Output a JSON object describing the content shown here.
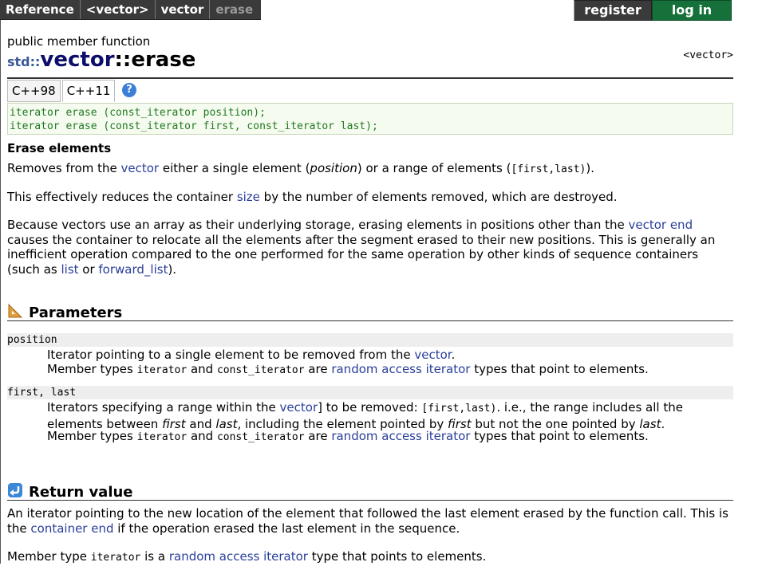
{
  "topbar": {
    "crumbs": [
      "Reference",
      "<vector>",
      "vector",
      "erase"
    ],
    "register": "register",
    "login": "log in"
  },
  "header": {
    "member_type": "public member function",
    "ns": "std::",
    "cls": "vector",
    "sep": "::",
    "fn": "erase",
    "header_tag": "<vector>"
  },
  "tabs": [
    "C++98",
    "C++11"
  ],
  "help_icon": "?",
  "prototypes": [
    "iterator erase (const_iterator position);",
    "iterator erase (const_iterator first, const_iterator last);"
  ],
  "intro": {
    "heading": "Erase elements",
    "p1_a": "Removes from the ",
    "p1_link": "vector",
    "p1_b": " either a single element (",
    "p1_pos": "position",
    "p1_c": ") or a range of elements (",
    "p1_range": "[first,last)",
    "p1_d": ").",
    "p2_a": "This effectively reduces the container ",
    "p2_link": "size",
    "p2_b": " by the number of elements removed, which are destroyed.",
    "p3_a": "Because vectors use an array as their underlying storage, erasing elements in positions other than the ",
    "p3_link": "vector end",
    "p3_b": " causes the container to relocate all the elements after the segment erased to their new positions. This is generally an inefficient operation compared to the one performed for the same operation by other kinds of sequence containers (such as ",
    "p3_link2": "list",
    "p3_c": " or ",
    "p3_link3": "forward_list",
    "p3_d": ")."
  },
  "params": {
    "title": "Parameters",
    "p1_name": "position",
    "p1_l1_a": "Iterator pointing to a single element to be removed from the ",
    "p1_l1_link": "vector",
    "p1_l1_b": ".",
    "p1_l2_a": "Member types ",
    "p1_l2_m1": "iterator",
    "p1_l2_b": " and ",
    "p1_l2_m2": "const_iterator",
    "p1_l2_c": " are ",
    "p1_l2_link": "random access iterator",
    "p1_l2_d": " types that point to elements.",
    "p2_name": "first, last",
    "p2_l1_a": "Iterators specifying a range within the ",
    "p2_l1_link": "vector",
    "p2_l1_b": "] to be removed: ",
    "p2_l1_m": "[first,last)",
    "p2_l1_c": ". i.e., the range includes all the elements between ",
    "p2_l1_i1": "first",
    "p2_l1_d": " and ",
    "p2_l1_i2": "last",
    "p2_l1_e": ", including the element pointed by ",
    "p2_l1_i3": "first",
    "p2_l1_f": " but not the one pointed by ",
    "p2_l1_i4": "last",
    "p2_l1_g": ".",
    "p2_l2_a": "Member types ",
    "p2_l2_m1": "iterator",
    "p2_l2_b": " and ",
    "p2_l2_m2": "const_iterator",
    "p2_l2_c": " are ",
    "p2_l2_link": "random access iterator",
    "p2_l2_d": " types that point to elements."
  },
  "retval": {
    "title": "Return value",
    "p1_a": "An iterator pointing to the new location of the element that followed the last element erased by the function call. This is the ",
    "p1_link": "container end",
    "p1_b": " if the operation erased the last element in the sequence.",
    "p2_a": "Member type ",
    "p2_m": "iterator",
    "p2_b": " is a ",
    "p2_link": "random access iterator",
    "p2_c": " type that points to elements."
  }
}
